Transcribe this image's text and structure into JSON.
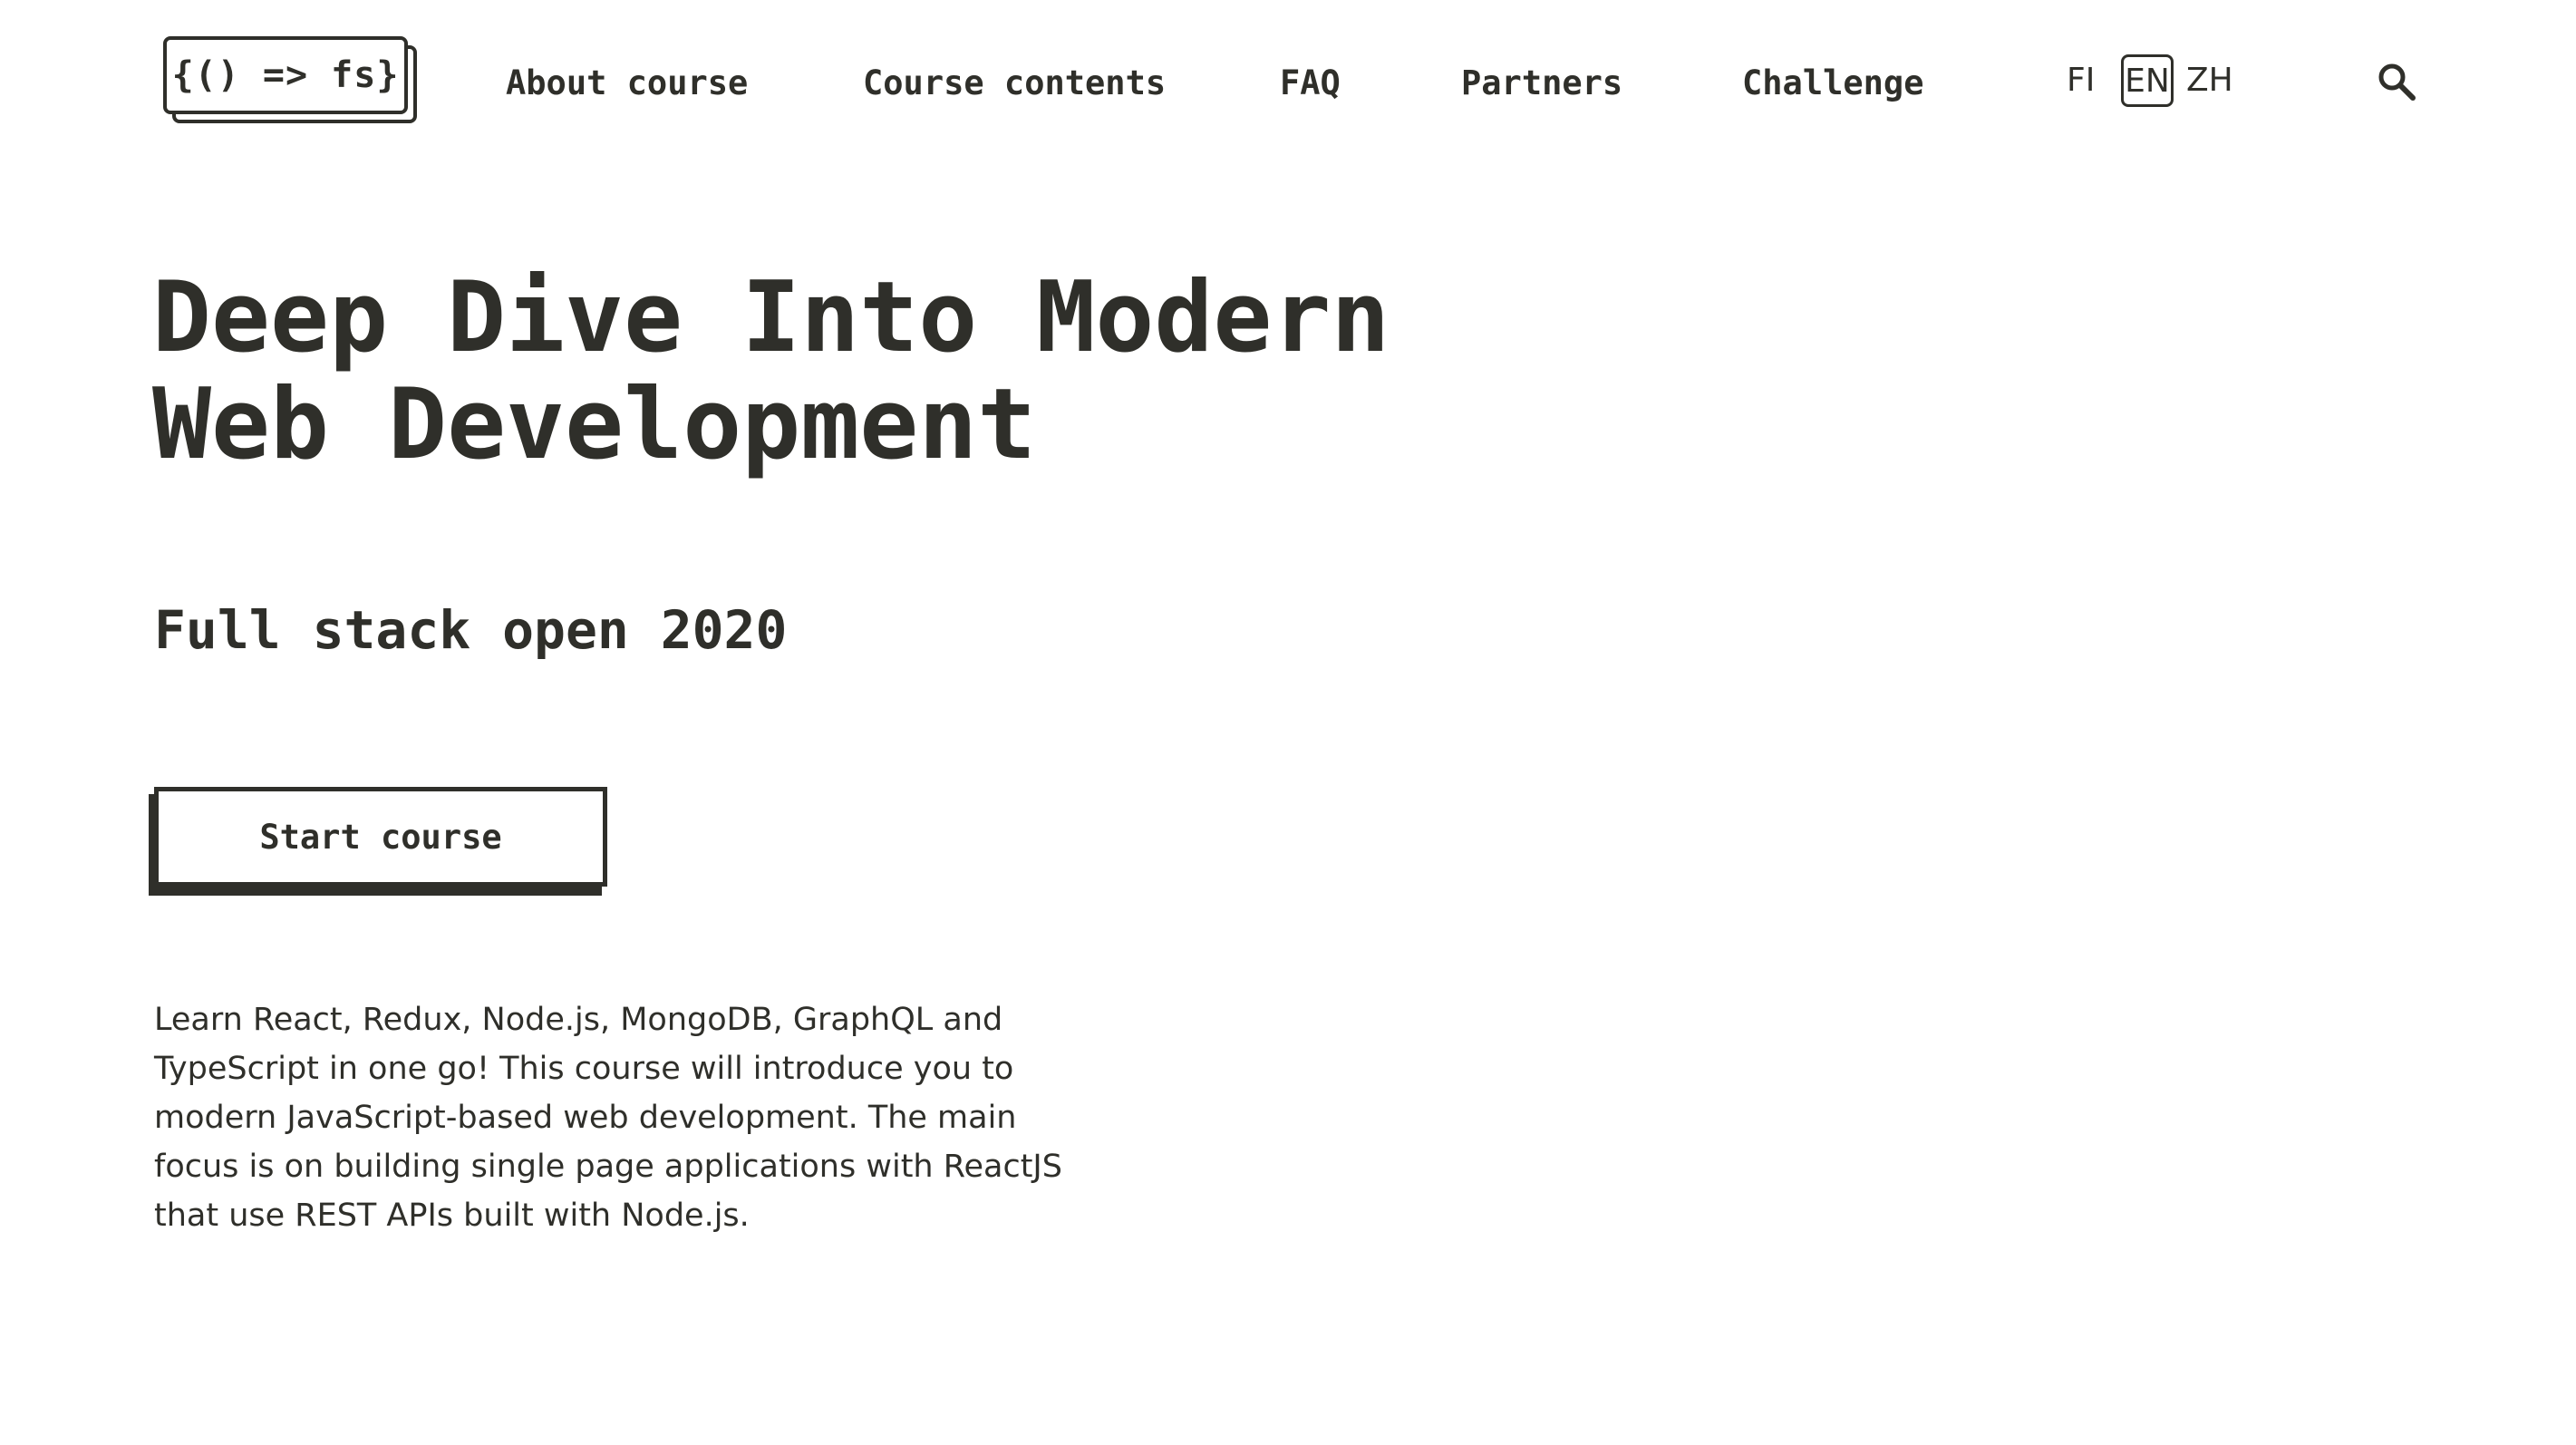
{
  "header": {
    "logo_text": "{() => fs}",
    "nav": [
      {
        "label": "About course"
      },
      {
        "label": "Course contents"
      },
      {
        "label": "FAQ"
      },
      {
        "label": "Partners"
      },
      {
        "label": "Challenge"
      }
    ],
    "languages": [
      {
        "label": "FI",
        "selected": false
      },
      {
        "label": "EN",
        "selected": true
      },
      {
        "label": "ZH",
        "selected": false
      }
    ],
    "search_icon": "search-icon"
  },
  "hero": {
    "title_line1": "Deep Dive Into Modern",
    "title_line2": "Web Development",
    "subtitle": "Full stack open 2020",
    "cta_label": "Start course",
    "intro": "Learn React, Redux, Node.js, MongoDB, GraphQL and TypeScript in one go! This course will introduce you to modern JavaScript-based web development. The main focus is on building single page applications with ReactJS that use REST APIs built with Node.js."
  },
  "colors": {
    "text": "#2f2f2a",
    "background": "#ffffff"
  }
}
